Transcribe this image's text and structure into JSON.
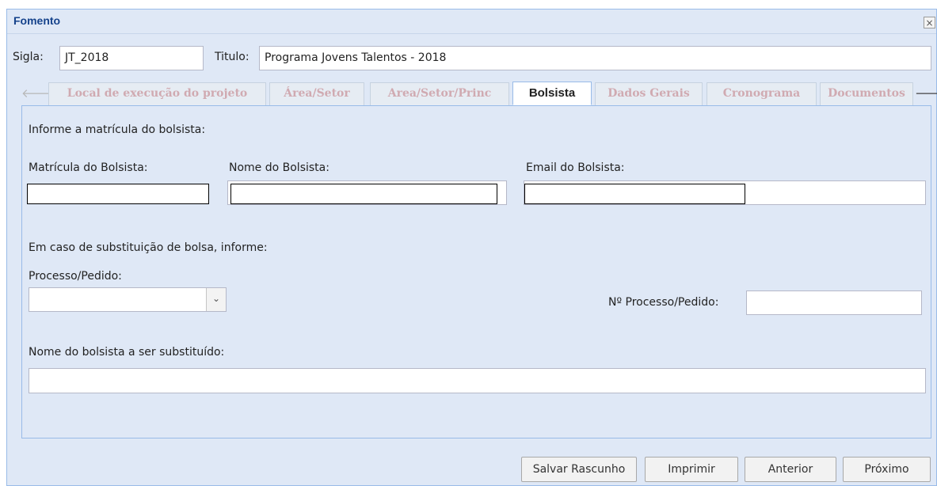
{
  "window": {
    "title": "Fomento",
    "close_icon": "×"
  },
  "header": {
    "sigla_label": "Sigla:",
    "sigla_value": "JT_2018",
    "titulo_label": "Titulo:",
    "titulo_value": "Programa Jovens Talentos - 2018"
  },
  "tabs": {
    "prev_icon": "🡐",
    "next_icon": "🡒",
    "items": [
      {
        "label": "Local de execução do projeto",
        "active": false
      },
      {
        "label": "Área/Setor",
        "active": false
      },
      {
        "label": "Area/Setor/Princ",
        "active": false
      },
      {
        "label": "Bolsista",
        "active": true
      },
      {
        "label": "Dados Gerais",
        "active": false
      },
      {
        "label": "Cronograma",
        "active": false
      },
      {
        "label": "Documentos",
        "active": false
      }
    ]
  },
  "form": {
    "intro": "Informe a matrícula do bolsista:",
    "matricula_label": "Matrícula do Bolsista:",
    "matricula_value": "",
    "nome_label": "Nome do Bolsista:",
    "nome_value": "",
    "email_label": "Email do Bolsista:",
    "email_value": "",
    "substituicao_intro": "Em caso de substituição de bolsa, informe:",
    "processo_label": "Processo/Pedido:",
    "processo_value": "",
    "processo_dropdown_icon": "⌄",
    "num_processo_label": "Nº Processo/Pedido:",
    "num_processo_value": "",
    "substituido_label": "Nome do bolsista a ser substituído:",
    "substituido_value": ""
  },
  "buttons": {
    "salvar": "Salvar Rascunho",
    "imprimir": "Imprimir",
    "anterior": "Anterior",
    "proximo": "Próximo"
  },
  "colors": {
    "window_bg": "#dfe8f6",
    "window_border": "#99bbe8",
    "title_text": "#15428b",
    "disabled_tab_text": "#d0aab1"
  }
}
